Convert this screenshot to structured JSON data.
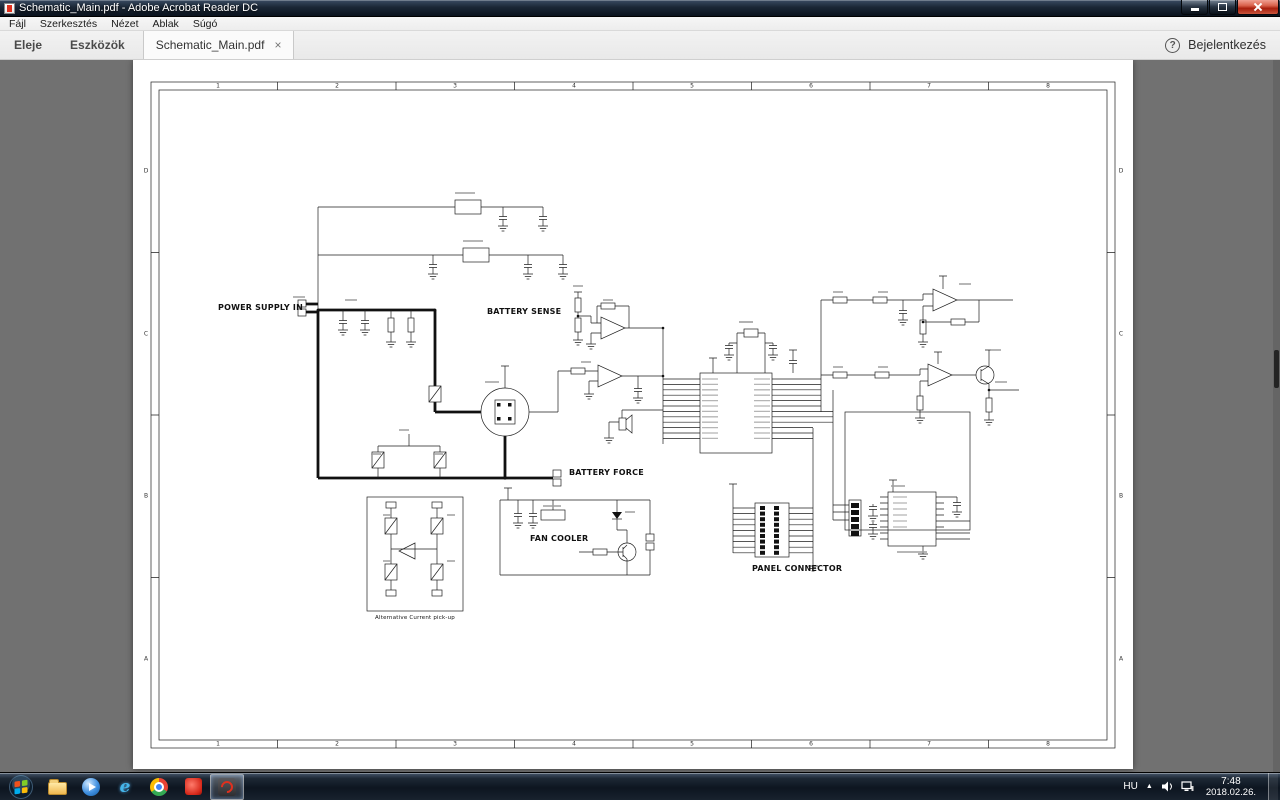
{
  "titlebar": {
    "title": "Schematic_Main.pdf - Adobe Acrobat Reader DC"
  },
  "menubar": {
    "items": [
      "Fájl",
      "Szerkesztés",
      "Nézet",
      "Ablak",
      "Súgó"
    ]
  },
  "tabbar": {
    "home_label": "Eleje",
    "tools_label": "Eszközök",
    "document_tab": "Schematic_Main.pdf",
    "close_tab_glyph": "×",
    "help_glyph": "?",
    "sign_in_label": "Bejelentkezés"
  },
  "document": {
    "page_labels": {
      "power_supply_in": "POWER SUPPLY IN",
      "battery_sense": "BATTERY SENSE",
      "battery_force": "BATTERY FORCE",
      "fan_cooler": "FAN COOLER",
      "panel_connector": "PANEL CONNECTOR",
      "alternative_pickup": "Alternative Current pick-up"
    },
    "grid": {
      "columns": [
        "1",
        "2",
        "3",
        "4",
        "5",
        "6",
        "7",
        "8"
      ],
      "rows": [
        "D",
        "C",
        "B",
        "A"
      ]
    }
  },
  "taskbar": {
    "ie_glyph": "e",
    "tray": {
      "language": "HU",
      "hidden_icons_glyph": "▲",
      "time": "7:48",
      "date": "2018.02.26."
    }
  },
  "colors": {
    "close_button_red": "#c9553c",
    "adobe_red": "#e0301e",
    "taskbar_glass": "#18222e"
  }
}
